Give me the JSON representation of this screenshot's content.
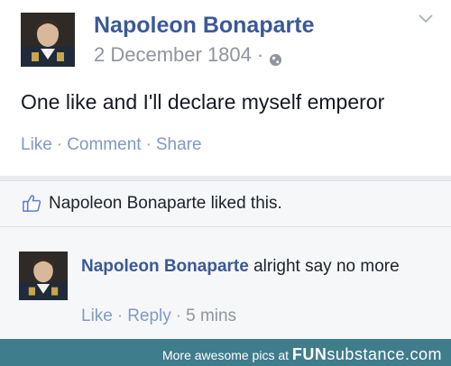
{
  "post": {
    "author": "Napoleon Bonaparte",
    "date": "2 December 1804",
    "dot": "·",
    "text": "One like and I'll declare myself emperor",
    "actions": {
      "like": "Like",
      "comment": "Comment",
      "share": "Share",
      "sep": "·"
    }
  },
  "likes": {
    "text": "Napoleon Bonaparte liked this."
  },
  "comment": {
    "author": "Napoleon Bonaparte",
    "text": " alright say no more",
    "actions": {
      "like": "Like",
      "reply": "Reply",
      "time": "5 mins",
      "sep": "·"
    }
  },
  "footer": {
    "prefix": "More awesome pics at ",
    "brand_part1": "FUN",
    "brand_part2": "substance",
    "brand_part3": ".com"
  },
  "colors": {
    "link_blue": "#3b5998",
    "action_blue": "#7f9ac4",
    "grey": "#90949c",
    "footer_bg": "#3f7c8c"
  },
  "icons": [
    "globe-icon",
    "chevron-down-icon",
    "thumbs-up-icon"
  ]
}
